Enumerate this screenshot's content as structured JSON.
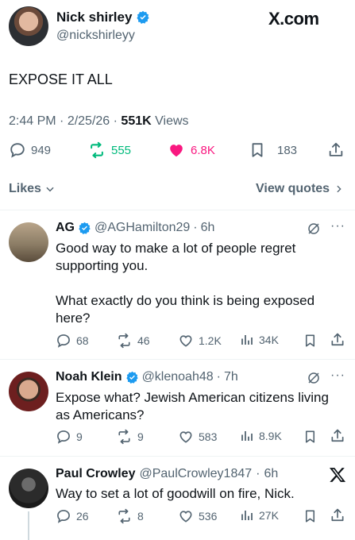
{
  "brand": "X.com",
  "post": {
    "author_name": "Nick shirley",
    "handle": "@nickshirleyy",
    "text": "EXPOSE IT ALL",
    "time": "2:44 PM",
    "date": "2/25/26",
    "views_count": "551K",
    "views_label": "Views",
    "stats": {
      "replies": "949",
      "reposts": "555",
      "likes": "6.8K",
      "bookmarks": "183"
    },
    "likes_label": "Likes",
    "view_quotes_label": "View quotes"
  },
  "replies": [
    {
      "author_name": "AG",
      "handle": "@AGHamilton29",
      "time": "6h",
      "text1": "Good way to make a lot of people regret supporting you.",
      "text2": "What exactly do you think is being exposed here?",
      "stats": {
        "replies": "68",
        "reposts": "46",
        "likes": "1.2K",
        "views": "34K"
      }
    },
    {
      "author_name": "Noah Klein",
      "handle": "@klenoah48",
      "time": "7h",
      "text1": "Expose what? Jewish American citizens living as Americans?",
      "stats": {
        "replies": "9",
        "reposts": "9",
        "likes": "583",
        "views": "8.9K"
      }
    },
    {
      "author_name": "Paul Crowley",
      "handle": "@PaulCrowley1847",
      "time": "6h",
      "text1": "Way to set a lot of goodwill on fire, Nick.",
      "stats": {
        "replies": "26",
        "reposts": "8",
        "likes": "536",
        "views": "27K"
      }
    }
  ],
  "colors": {
    "verified": "#1d9bf0",
    "repost": "#00ba7c",
    "like": "#f91880",
    "gray": "#536471"
  }
}
